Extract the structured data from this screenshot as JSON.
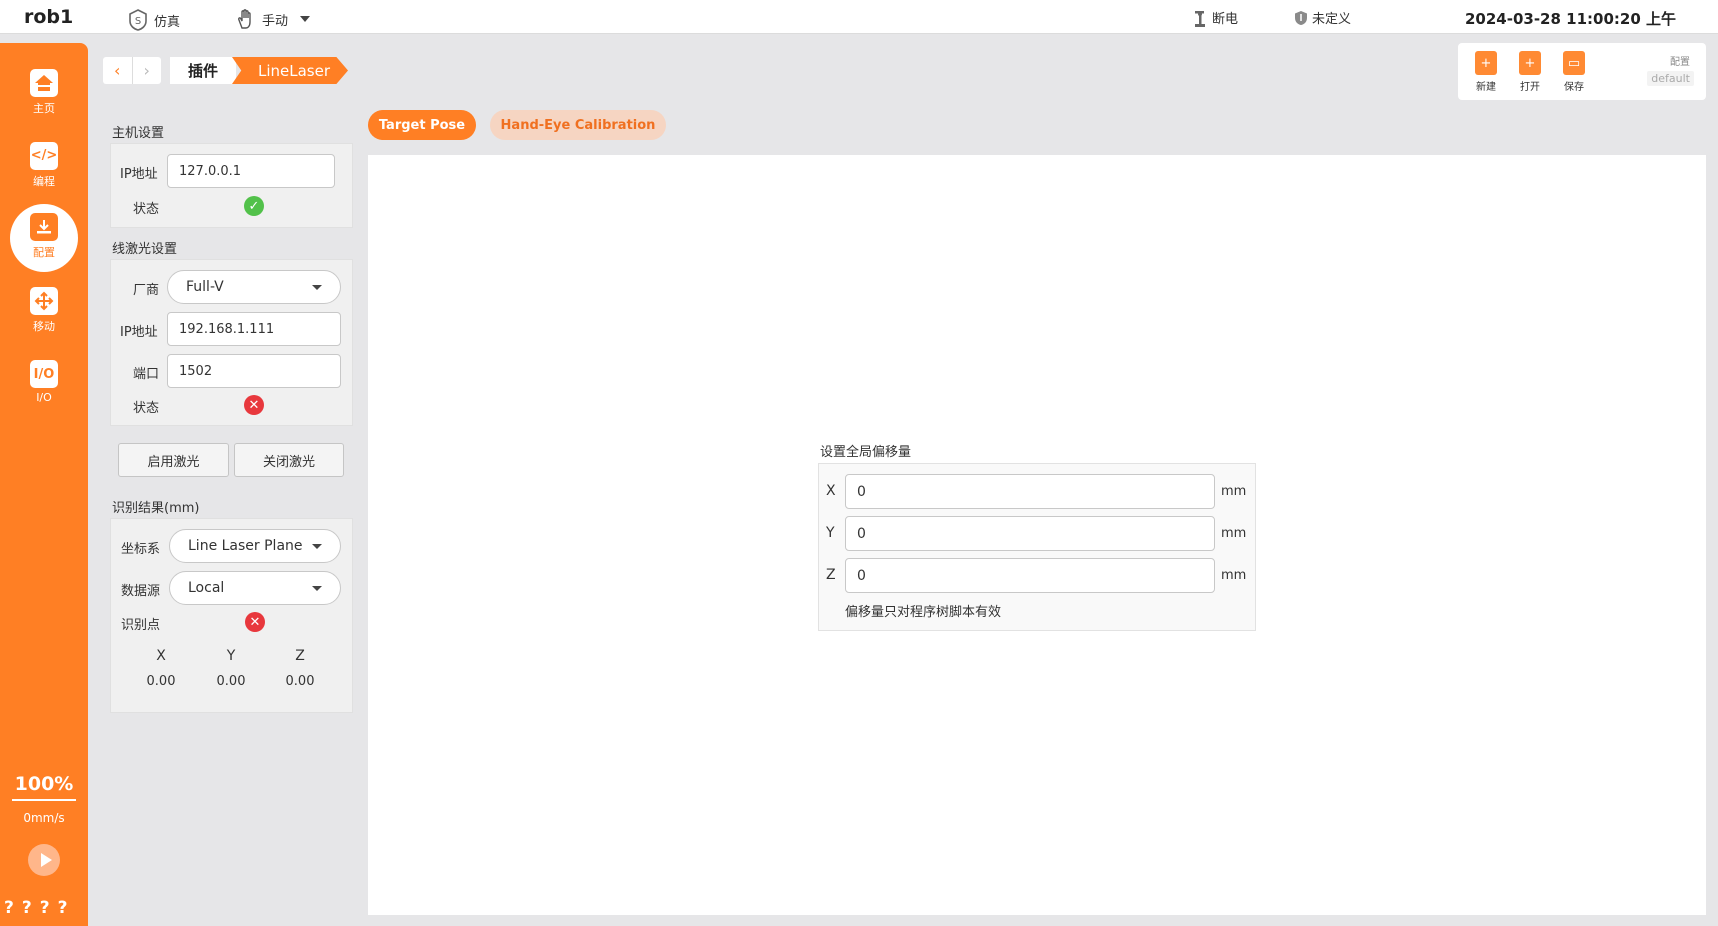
{
  "topbar": {
    "robot_name": "rob1",
    "sim_label": "仿真",
    "mode_label": "手动",
    "power_label": "断电",
    "safety_label": "未定义",
    "datetime": "2024-03-28 11:00:20 上午"
  },
  "sidebar": {
    "items": [
      {
        "label": "主页",
        "icon": "home-icon"
      },
      {
        "label": "编程",
        "icon": "code-icon"
      },
      {
        "label": "配置",
        "icon": "config-icon"
      },
      {
        "label": "移动",
        "icon": "move-icon"
      },
      {
        "label": "I/O",
        "icon": "io-icon"
      }
    ],
    "io_glyph": "I/O",
    "code_glyph": "</>",
    "speed_percent": "100%",
    "speed_value": "0mm/s",
    "bottom_marks": "????"
  },
  "breadcrumb": {
    "level1": "插件",
    "level2": "LineLaser"
  },
  "toolbar": {
    "new_label": "新建",
    "open_label": "打开",
    "save_label": "保存",
    "config_label": "配置",
    "config_value": "default"
  },
  "host": {
    "title": "主机设置",
    "ip_label": "IP地址",
    "ip_value": "127.0.0.1",
    "status_label": "状态"
  },
  "laser": {
    "title": "线激光设置",
    "vendor_label": "厂商",
    "vendor_value": "Full-V",
    "ip_label": "IP地址",
    "ip_value": "192.168.1.111",
    "port_label": "端口",
    "port_value": "1502",
    "status_label": "状态",
    "enable_button": "启用激光",
    "disable_button": "关闭激光"
  },
  "result": {
    "title": "识别结果(mm)",
    "frame_label": "坐标系",
    "frame_value": "Line Laser Plane",
    "source_label": "数据源",
    "source_value": "Local",
    "point_label": "识别点",
    "headers": [
      "X",
      "Y",
      "Z"
    ],
    "values": [
      "0.00",
      "0.00",
      "0.00"
    ]
  },
  "tabs": {
    "active": "Target Pose",
    "inactive": "Hand-Eye Calibration"
  },
  "offset": {
    "title": "设置全局偏移量",
    "x_label": "X",
    "y_label": "Y",
    "z_label": "Z",
    "x_value": "0",
    "y_value": "0",
    "z_value": "0",
    "unit": "mm",
    "note": "偏移量只对程序树脚本有效"
  },
  "colors": {
    "accent": "#ff7f24",
    "ok": "#52c14a",
    "error": "#e8383d"
  }
}
